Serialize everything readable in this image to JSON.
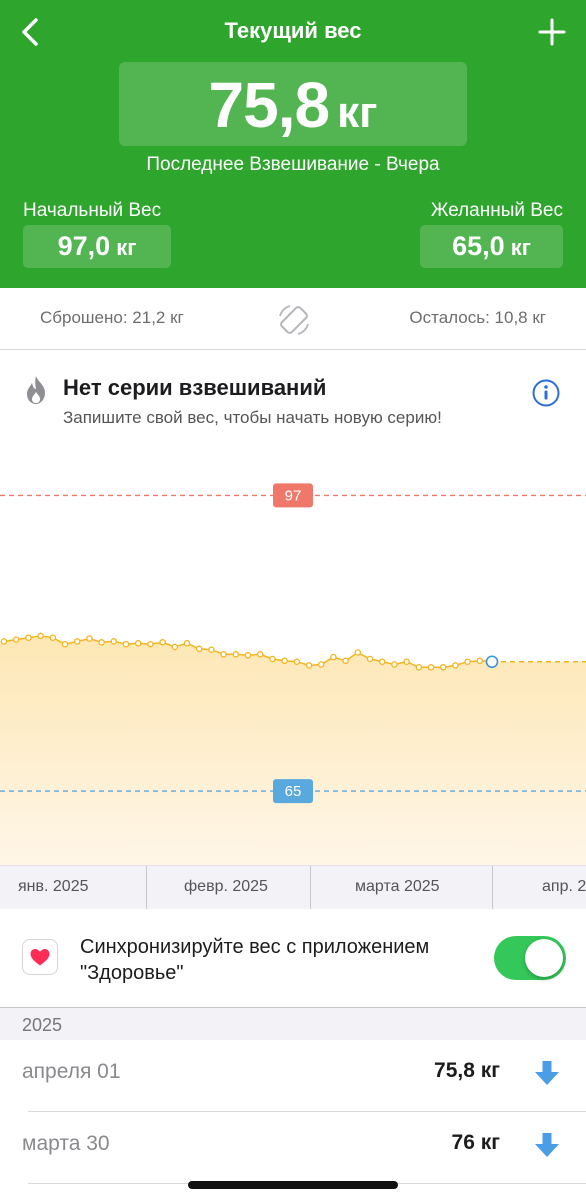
{
  "header": {
    "title": "Текущий вес",
    "current_weight": "75,8",
    "unit": "кг",
    "last_weigh_in": "Последнее Взвешивание - Вчера",
    "start_label": "Начальный Вес",
    "start_value": "97,0",
    "goal_label": "Желанный Вес",
    "goal_value": "65,0",
    "color": "#2ea52c"
  },
  "progress": {
    "lost": "Сброшено: 21,2 кг",
    "remaining": "Осталось: 10,8 кг"
  },
  "streak": {
    "title": "Нет серии взвешиваний",
    "subtitle": "Запишите свой вес, чтобы начать новую серию!",
    "icon": "flame-icon"
  },
  "chart_data": {
    "type": "area",
    "x_labels": [
      "янв. 2025",
      "февр. 2025",
      "марта 2025",
      "апр. 2"
    ],
    "start_line": 97,
    "goal_line": 65,
    "start_label": "97",
    "goal_label": "65",
    "ylim": [
      57,
      103
    ],
    "start_color": "#f0786a",
    "goal_color": "#5aa9de",
    "line_color": "#f2b51d",
    "series": [
      {
        "values": [
          81.2,
          81.4,
          81.6,
          81.8,
          81.6,
          80.9,
          81.2,
          81.5,
          81.1,
          81.2,
          80.9,
          81.0,
          80.9,
          81.1,
          80.6,
          81.0,
          80.4,
          80.3,
          79.8,
          79.8,
          79.7,
          79.8,
          79.3,
          79.1,
          79.0,
          78.6,
          78.7,
          79.5,
          79.1,
          80.0,
          79.3,
          79.0,
          78.7,
          79.0,
          78.4,
          78.4,
          78.4,
          78.6,
          79.0,
          79.1,
          79.0
        ]
      }
    ]
  },
  "months": [
    "янв. 2025",
    "февр. 2025",
    "марта 2025",
    "апр. 2"
  ],
  "sync": {
    "text": "Синхронизируйте вес с приложением \"Здоровье\"",
    "enabled": true
  },
  "history": {
    "year": "2025",
    "entries": [
      {
        "date": "апреля 01",
        "weight": "75,8 кг"
      },
      {
        "date": "марта 30",
        "weight": "76 кг"
      }
    ]
  }
}
